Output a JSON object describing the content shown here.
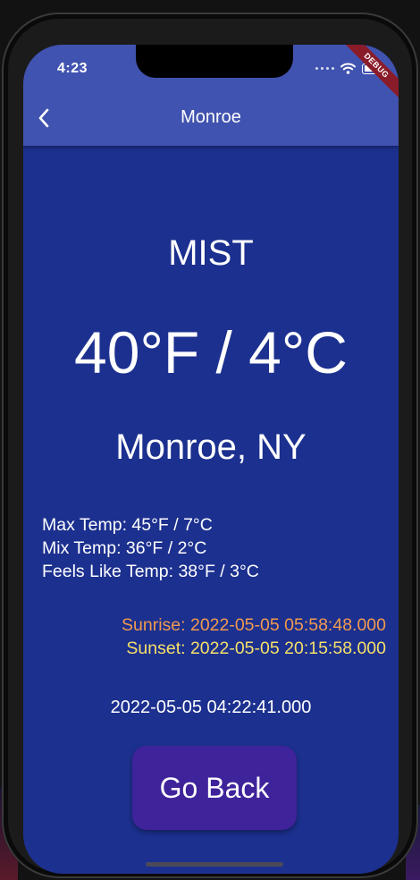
{
  "status_bar": {
    "time": "4:23",
    "debug_label": "DEBUG"
  },
  "app_bar": {
    "title": "Monroe",
    "back_icon": "chevron-left-icon"
  },
  "weather": {
    "description": "MIST",
    "temperature": "40°F / 4°C",
    "location": "Monroe, NY",
    "max_temp": "Max Temp: 45°F / 7°C",
    "min_temp": "Mix Temp: 36°F / 2°C",
    "feels_like": "Feels Like Temp: 38°F / 3°C",
    "sunrise": "Sunrise: 2022-05-05 05:58:48.000",
    "sunset": "Sunset: 2022-05-05 20:15:58.000",
    "timestamp": "2022-05-05 04:22:41.000"
  },
  "actions": {
    "go_back_label": "Go Back"
  },
  "colors": {
    "app_bar": "#4153b0",
    "background": "#1c308f",
    "button": "#3f239a",
    "sunrise": "#f09a4f",
    "sunset": "#f5e06a"
  }
}
